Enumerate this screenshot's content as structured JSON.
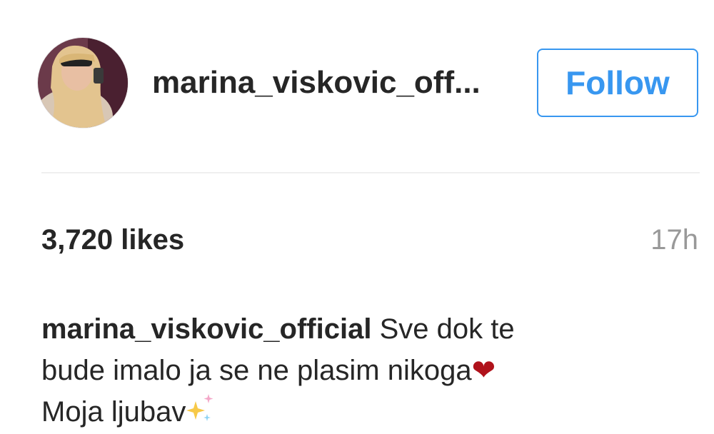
{
  "post": {
    "username": "marina_viskovic_off...",
    "follow_label": "Follow",
    "likes": "3,720 likes",
    "time": "17h",
    "caption": {
      "username": "marina_viskovic_official",
      "line1": "Sve dok te",
      "line2": "bude imalo ja se ne plasim nikoga",
      "line2_emoji": "❤",
      "line3": "Moja ljubav",
      "line3_emoji": "sparkles-icon"
    }
  },
  "colors": {
    "accent": "#3897f0",
    "text": "#262626",
    "muted": "#999999",
    "heart": "#b0121b",
    "divider": "#efefef"
  }
}
